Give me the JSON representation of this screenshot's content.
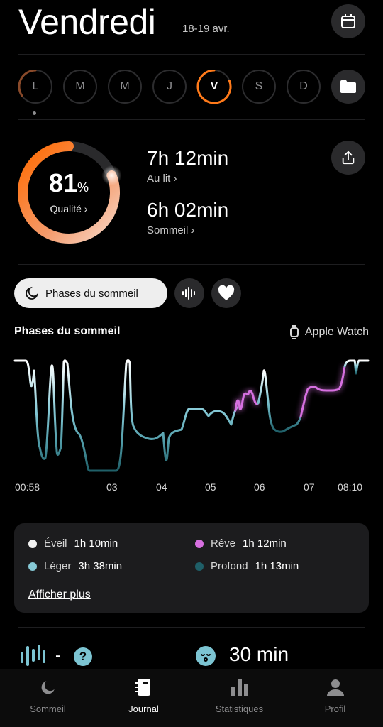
{
  "header": {
    "title": "Vendredi",
    "date_range": "18-19 avr."
  },
  "days": [
    {
      "label": "L",
      "ring": 0.35
    },
    {
      "label": "M",
      "ring": 0
    },
    {
      "label": "M",
      "ring": 0
    },
    {
      "label": "J",
      "ring": 0
    },
    {
      "label": "V",
      "ring": 0.81,
      "selected": true
    },
    {
      "label": "S",
      "ring": 0
    },
    {
      "label": "D",
      "ring": 0
    }
  ],
  "quality": {
    "value": "81",
    "unit": "%",
    "label": "Qualité",
    "fraction": 0.81
  },
  "in_bed": {
    "value": "7h 12min",
    "label": "Au lit"
  },
  "sleep": {
    "value": "6h 02min",
    "label": "Sommeil"
  },
  "chips": {
    "phases_label": "Phases du sommeil"
  },
  "phases": {
    "title": "Phases du sommeil",
    "device": "Apple Watch"
  },
  "chart_data": {
    "type": "line",
    "x_ticks": [
      "00:58",
      "03",
      "04",
      "05",
      "06",
      "07",
      "08:10"
    ],
    "stages": [
      "Éveil",
      "Léger",
      "Rêve",
      "Profond"
    ],
    "series": [
      {
        "stage": "Éveil",
        "color": "#ffffff"
      },
      {
        "stage": "Léger",
        "color": "#86c9d6"
      },
      {
        "stage": "Rêve",
        "color": "#d66fe0"
      },
      {
        "stage": "Profond",
        "color": "#1f5f68"
      }
    ]
  },
  "legend": {
    "items": [
      {
        "label": "Éveil",
        "value": "1h 10min",
        "color": "#f2f2f2"
      },
      {
        "label": "Rêve",
        "value": "1h 12min",
        "color": "#d66fe0"
      },
      {
        "label": "Léger",
        "value": "3h 38min",
        "color": "#86c9d6"
      },
      {
        "label": "Profond",
        "value": "1h 13min",
        "color": "#1f5f68"
      }
    ],
    "more": "Afficher plus"
  },
  "bottom_stats": {
    "snore_value": "-",
    "help": "?",
    "time_to_sleep": "30 min"
  },
  "tabs": [
    {
      "label": "Sommeil",
      "icon": "moon-icon"
    },
    {
      "label": "Journal",
      "icon": "journal-icon",
      "active": true
    },
    {
      "label": "Statistiques",
      "icon": "bar-chart-icon"
    },
    {
      "label": "Profil",
      "icon": "person-icon"
    }
  ],
  "colors": {
    "accent": "#ff7a1a",
    "light": "#86c9d6",
    "rem": "#d66fe0",
    "deep": "#1f5f68"
  }
}
